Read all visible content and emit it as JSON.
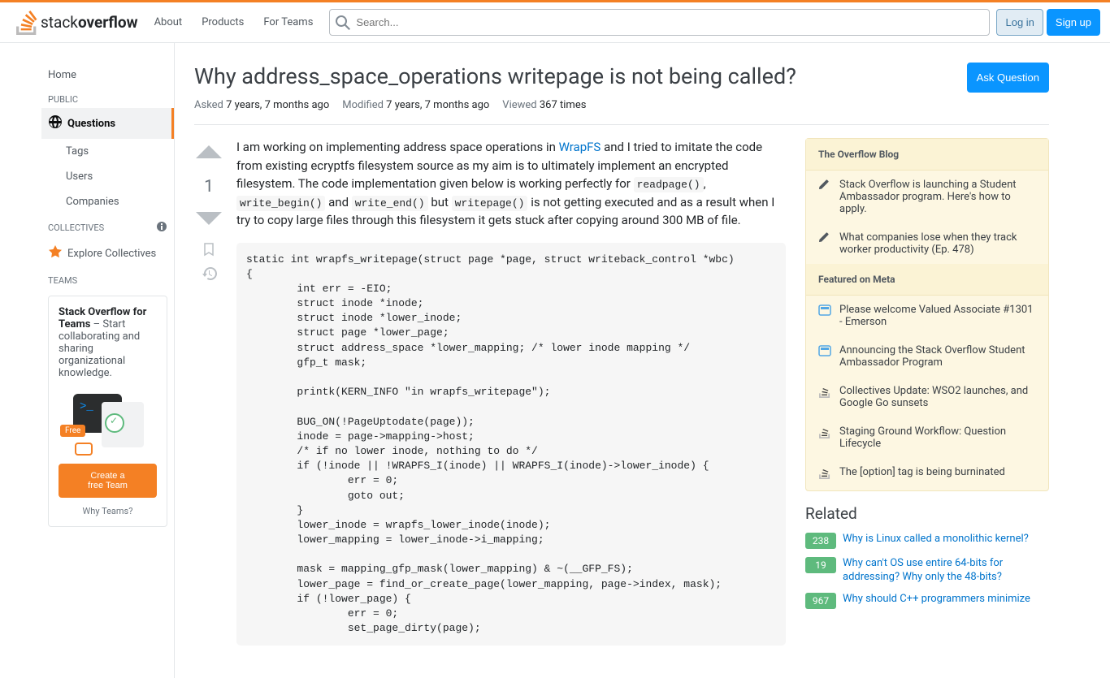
{
  "header": {
    "nav": {
      "about": "About",
      "products": "Products",
      "for_teams": "For Teams"
    },
    "search_placeholder": "Search...",
    "login": "Log in",
    "signup": "Sign up"
  },
  "sidebar": {
    "home": "Home",
    "public": "PUBLIC",
    "questions": "Questions",
    "tags": "Tags",
    "users": "Users",
    "companies": "Companies",
    "collectives": "COLLECTIVES",
    "explore": "Explore Collectives",
    "teams": "TEAMS",
    "teams_box_strong": "Stack Overflow for Teams",
    "teams_box_text": " – Start collaborating and sharing organizational knowledge.",
    "teams_free": "Free",
    "create_team": "Create a free Team",
    "why_teams": "Why Teams?"
  },
  "question": {
    "title": "Why address_space_operations writepage is not being called?",
    "ask": "Ask Question",
    "asked_label": "Asked",
    "asked_value": "7 years, 7 months ago",
    "modified_label": "Modified",
    "modified_value": "7 years, 7 months ago",
    "viewed_label": "Viewed",
    "viewed_value": "367 times",
    "vote_count": "1",
    "body_p1_a": "I am working on implementing address space operations in ",
    "body_link": "WrapFS",
    "body_p1_b": " and I tried to imitate the code from existing ecryptfs filesystem source as my aim is to ultimately implement an encrypted filesystem. The code implementation given below is working perfectly for ",
    "code1": "readpage()",
    "code2": "write_begin()",
    "code3": "write_end()",
    "code4": "writepage()",
    "body_p1_c": " and ",
    "body_p1_d": " but ",
    "body_p1_e": " is not getting executed and as a result when I try to copy large files through this filesystem it gets stuck after copying around 300 MB of file.",
    "code_block": "static int wrapfs_writepage(struct page *page, struct writeback_control *wbc)\n{\n        int err = -EIO;\n        struct inode *inode;\n        struct inode *lower_inode;\n        struct page *lower_page;\n        struct address_space *lower_mapping; /* lower inode mapping */\n        gfp_t mask;\n\n        printk(KERN_INFO \"in wrapfs_writepage\");\n\n        BUG_ON(!PageUptodate(page));\n        inode = page->mapping->host;\n        /* if no lower inode, nothing to do */\n        if (!inode || !WRAPFS_I(inode) || WRAPFS_I(inode)->lower_inode) {\n                err = 0;\n                goto out;\n        }\n        lower_inode = wrapfs_lower_inode(inode);\n        lower_mapping = lower_inode->i_mapping;\n\n        mask = mapping_gfp_mask(lower_mapping) & ~(__GFP_FS);\n        lower_page = find_or_create_page(lower_mapping, page->index, mask);\n        if (!lower_page) {\n                err = 0;\n                set_page_dirty(page);"
  },
  "right": {
    "blog_title": "The Overflow Blog",
    "blog_items": [
      "Stack Overflow is launching a Student Ambassador program. Here's how to apply.",
      "What companies lose when they track worker productivity (Ep. 478)"
    ],
    "meta_title": "Featured on Meta",
    "meta_items": [
      {
        "icon": "meta",
        "text": "Please welcome Valued Associate #1301 - Emerson"
      },
      {
        "icon": "meta",
        "text": "Announcing the Stack Overflow Student Ambassador Program"
      },
      {
        "icon": "so",
        "text": "Collectives Update: WSO2 launches, and Google Go sunsets"
      },
      {
        "icon": "so",
        "text": "Staging Ground Workflow: Question Lifecycle"
      },
      {
        "icon": "so",
        "text": "The [option] tag is being burninated"
      }
    ],
    "related_title": "Related",
    "related": [
      {
        "score": "238",
        "text": "Why is Linux called a monolithic kernel?"
      },
      {
        "score": "19",
        "text": "Why can't OS use entire 64-bits for addressing? Why only the 48-bits?"
      },
      {
        "score": "967",
        "text": "Why should C++ programmers minimize"
      }
    ]
  }
}
